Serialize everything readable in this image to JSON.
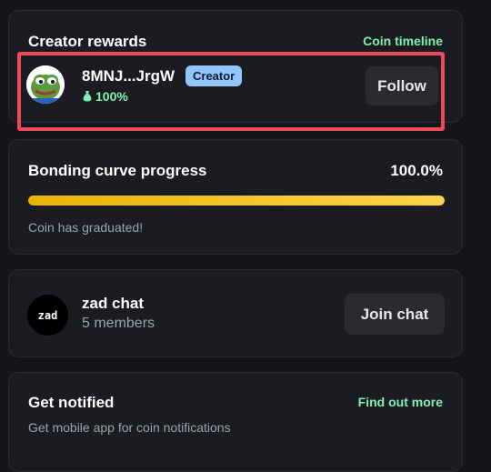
{
  "rewards": {
    "title": "Creator rewards",
    "timeline_link": "Coin timeline",
    "creator": {
      "name": "8MNJ...JrgW",
      "badge": "Creator",
      "share": "100%",
      "share_icon": "money-bag-icon",
      "avatar_icon": "pepe-frog-avatar"
    },
    "follow_label": "Follow"
  },
  "bonding": {
    "title": "Bonding curve progress",
    "percent_label": "100.0%",
    "progress": 1.0,
    "status": "Coin has graduated!"
  },
  "chat": {
    "avatar_text": "zad",
    "name": "zad chat",
    "members": "5 members",
    "join_label": "Join chat"
  },
  "notify": {
    "title": "Get notified",
    "link": "Find out more",
    "subtitle": "Get mobile app for coin notifications"
  },
  "colors": {
    "accent_green": "#86efac",
    "badge_blue": "#93c5fd",
    "highlight_red": "#ef4a5c",
    "progress_gold": "#eab308"
  }
}
